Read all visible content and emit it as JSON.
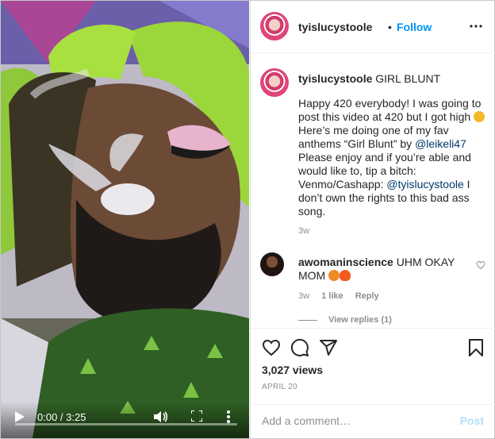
{
  "header": {
    "username": "tyislucystoole",
    "separator": "•",
    "follow_label": "Follow"
  },
  "video": {
    "time": "0:00 / 3:25",
    "progress": 0
  },
  "caption": {
    "username": "tyislucystoole",
    "title": "GIRL BLUNT",
    "text_1": "Happy 420 everybody! I was going to post this video at 420 but I got high",
    "text_2": " Here’s me doing one of my fav anthems “Girl Blunt” by ",
    "mention_1": "@leikeli47",
    "text_3": " Please enjoy and if you’re able and would like to, tip a bitch: Venmo/Cashapp: ",
    "mention_2": "@tyislucystoole",
    "text_4": " I don’t own the rights to this bad ass song.",
    "time": "3w"
  },
  "comment": {
    "username": "awomaninscience",
    "text": "UHM OKAY MOM",
    "time": "3w",
    "likes": "1 like",
    "reply_label": "Reply",
    "view_replies": "View replies (1)"
  },
  "stats": {
    "views": "3,027 views",
    "date": "APRIL 20"
  },
  "add_comment": {
    "placeholder": "Add a comment…",
    "post_label": "Post"
  },
  "icons": {
    "heart": "heart-icon",
    "comment": "comment-icon",
    "share": "share-icon",
    "save": "bookmark-icon",
    "play": "play-icon",
    "volume": "volume-icon",
    "fullscreen": "fullscreen-icon",
    "more": "more-icon"
  },
  "colors": {
    "accent": "#0095f6",
    "post_disabled": "#b2dffc",
    "muted_text": "#8e8e8e"
  }
}
